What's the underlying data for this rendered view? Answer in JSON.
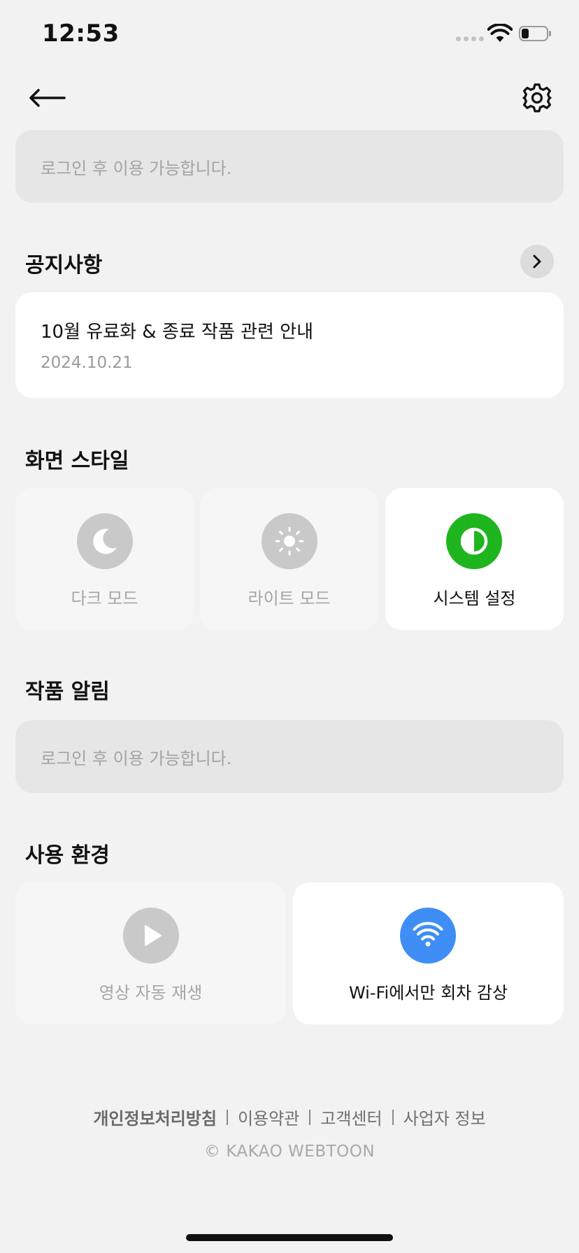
{
  "status_bar": {
    "time": "12:53"
  },
  "nav": {
    "back_icon": "arrow-left-icon",
    "settings_icon": "gear-icon"
  },
  "login_banner": {
    "text": "로그인 후 이용 가능합니다."
  },
  "notice": {
    "title": "공지사항",
    "item_title": "10월 유료화 & 종료 작품 관련 안내",
    "item_date": "2024.10.21"
  },
  "screen_style": {
    "title": "화면 스타일",
    "options": [
      {
        "label": "다크 모드",
        "icon": "moon-icon",
        "selected": false
      },
      {
        "label": "라이트 모드",
        "icon": "sun-icon",
        "selected": false
      },
      {
        "label": "시스템 설정",
        "icon": "contrast-icon",
        "selected": true
      }
    ],
    "accent_color": "#1fb51e"
  },
  "work_alerts": {
    "title": "작품 알림",
    "text": "로그인 후 이용 가능합니다."
  },
  "usage": {
    "title": "사용 환경",
    "options": [
      {
        "label": "영상 자동 재생",
        "icon": "play-icon",
        "selected": false
      },
      {
        "label": "Wi-Fi에서만 회차 감상",
        "icon": "wifi-icon",
        "selected": true
      }
    ],
    "accent_color": "#3f8ef5"
  },
  "footer": {
    "links": [
      "개인정보처리방침",
      "이용약관",
      "고객센터",
      "사업자 정보"
    ],
    "copyright": "© KAKAO WEBTOON"
  }
}
